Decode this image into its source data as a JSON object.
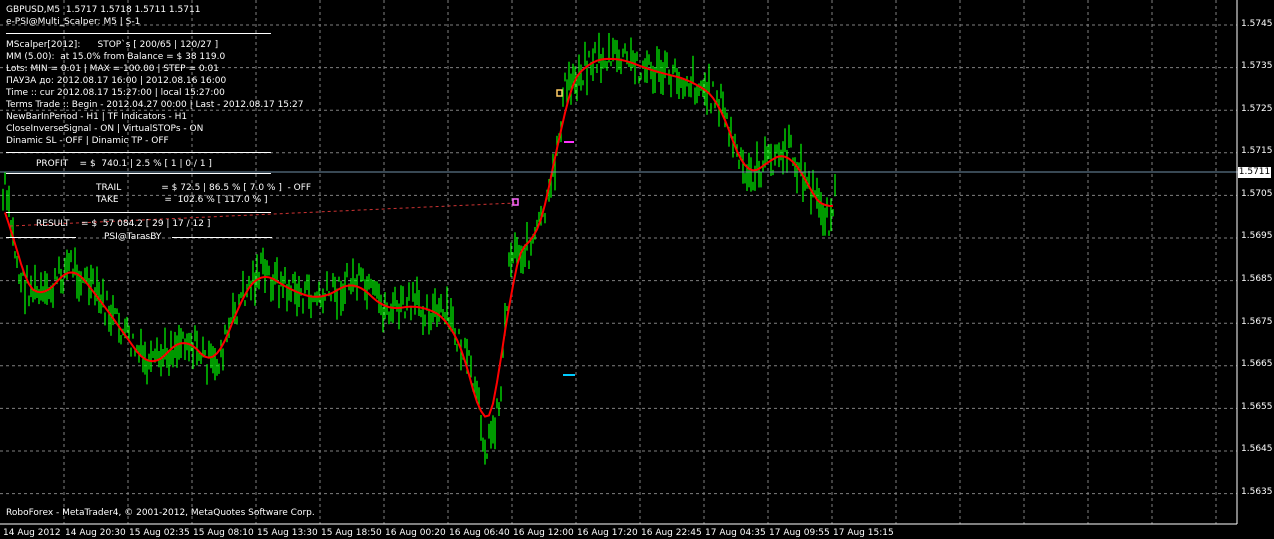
{
  "window": {
    "symbol_line": "GBPUSD,M5  1.5717 1.5718 1.5711 1.5711",
    "expert_line": "e-PSI@Multi_Scalper: M5 | S-1",
    "copyright": "RoboForex - MetaTrader4, © 2001-2012, MetaQuotes Software Corp."
  },
  "info_panel": {
    "lines": [
      "MScalper[2012]:      STOP`s [ 200/65 | 120/27 ]",
      "MM (5.00):  at 15.0% from Balance = $ 38 119.0",
      "Lots: MIN = 0.01 | MAX = 100.00 | STEP = 0.01",
      "ПАУЗА до: 2012.08.17 16:00 | 2012.08.16 16:00",
      "Time :: cur 2012.08.17 15:27:00 | local 15:27:00",
      "Terms Trade :: Begin - 2012.04.27 00:00 | Last - 2012.08.17 15:27",
      "NewBarInPeriod - H1 | TF Indicators - H1",
      "CloseInverseSignal - ON | VirtualSTOPs - ON",
      "Dinamic SL - OFF | Dinamic TP - OFF"
    ],
    "profit": "PROFIT    = $  740.1 | 2.5 % [ 1 | 0 / 1 ]",
    "trail": "TRAIL              = $ 72.5 | 86.5 % [ 7.0 % ]  - OFF",
    "take": "TAKE                =  102.6 % [ 117.0 % ]",
    "result": "RESULT    = $  57 084.2 [ 29 | 17 / 12 ]",
    "signature": "PSI@TarasBY"
  },
  "price_axis": {
    "labels": [
      "1.5745",
      "1.5735",
      "1.5725",
      "1.5715",
      "1.5705",
      "1.5695",
      "1.5685",
      "1.5675",
      "1.5665",
      "1.5655",
      "1.5645",
      "1.5635"
    ],
    "current_price": "1.5711"
  },
  "time_axis": {
    "labels": [
      "14 Aug 2012",
      "14 Aug 20:30",
      "15 Aug 02:35",
      "15 Aug 08:10",
      "15 Aug 13:30",
      "15 Aug 18:50",
      "16 Aug 00:20",
      "16 Aug 06:40",
      "16 Aug 12:00",
      "16 Aug 17:20",
      "16 Aug 22:45",
      "17 Aug 04:35",
      "17 Aug 09:55",
      "17 Aug 15:15"
    ]
  },
  "colors": {
    "background": "#000000",
    "grid": "#808080",
    "price_bars": "#00ff00",
    "moving_average": "#ff0000",
    "current_price_line": "#6f8fa8"
  }
}
